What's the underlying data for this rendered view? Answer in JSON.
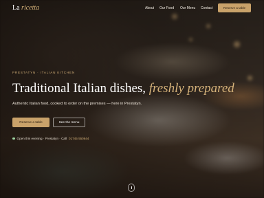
{
  "brand": {
    "name_plain": "La",
    "name_accent": "ricetta"
  },
  "nav": {
    "items": [
      {
        "label": "About"
      },
      {
        "label": "Our Food"
      },
      {
        "label": "Our Menu"
      },
      {
        "label": "Contact"
      }
    ],
    "cta_label": "Reserve a table"
  },
  "hero": {
    "eyebrow": "Prestatyn · Italian Kitchen",
    "title_plain": "Traditional Italian dishes,",
    "title_accent": "freshly prepared",
    "subtitle": "Authentic Italian food, cooked to order on the premises — here in Prestatyn.",
    "primary_button": "Reserve a table",
    "secondary_button": "See the menu",
    "status_text": "Open this evening · Prestatyn · Call",
    "phone": "01745 550644"
  },
  "colors": {
    "accent": "#c9a26a",
    "accent_text": "#d5b27a",
    "status_dot": "#9fd6a3"
  },
  "icons": {
    "status": "status-dot-icon",
    "scroll": "scroll-indicator-icon"
  }
}
